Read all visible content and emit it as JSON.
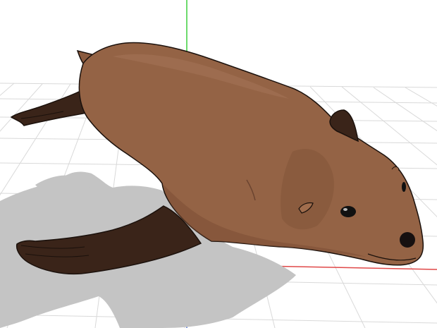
{
  "viewport": {
    "background_color": "#ffffff",
    "grid_line_color": "#d9d9d9",
    "x_axis_color": "#e04848",
    "y_axis_color": "#3ccf3c",
    "z_axis_color": "#4a6ed8"
  },
  "model": {
    "subject": "sea-lion",
    "body_color": "#946345",
    "body_shadow_color": "#7b4f35",
    "body_highlight_color": "#a8785a",
    "flipper_color": "#3a2419",
    "outline_color": "#1b110c",
    "eye_color": "#111111",
    "nose_color": "#161010"
  },
  "ground_shadow": {
    "color": "#c4c4c4"
  }
}
